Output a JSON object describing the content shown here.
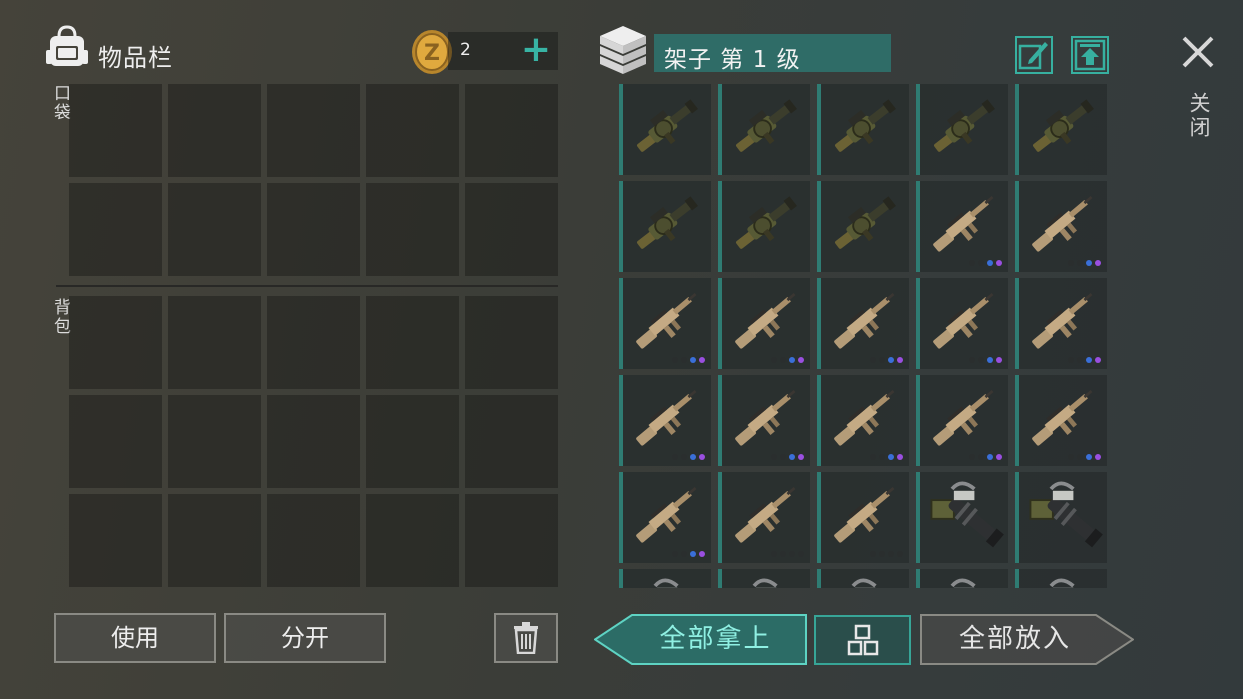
{
  "inventory": {
    "title": "物品栏",
    "coins": "2",
    "pocket_label": "口袋",
    "backpack_label": "背包",
    "pocket_rows": 2,
    "backpack_rows": 3,
    "columns": 5
  },
  "actions": {
    "use": "使用",
    "split": "分开",
    "take_all": "全部拿上",
    "put_all": "全部放入"
  },
  "container": {
    "title": "架子 第 1 级",
    "close_label": "关闭",
    "items": [
      {
        "type": "grenade-launcher",
        "dots": []
      },
      {
        "type": "grenade-launcher",
        "dots": []
      },
      {
        "type": "grenade-launcher",
        "dots": []
      },
      {
        "type": "grenade-launcher",
        "dots": []
      },
      {
        "type": "grenade-launcher",
        "dots": []
      },
      {
        "type": "grenade-launcher",
        "dots": []
      },
      {
        "type": "grenade-launcher",
        "dots": []
      },
      {
        "type": "grenade-launcher",
        "dots": []
      },
      {
        "type": "assault-rifle",
        "dots": [
          "off",
          "off",
          "blue",
          "purple"
        ]
      },
      {
        "type": "assault-rifle",
        "dots": [
          "off",
          "off",
          "blue",
          "purple"
        ]
      },
      {
        "type": "assault-rifle",
        "dots": [
          "off",
          "off",
          "blue",
          "purple"
        ]
      },
      {
        "type": "assault-rifle",
        "dots": [
          "off",
          "off",
          "blue",
          "purple"
        ]
      },
      {
        "type": "assault-rifle",
        "dots": [
          "off",
          "off",
          "blue",
          "purple"
        ]
      },
      {
        "type": "assault-rifle",
        "dots": [
          "off",
          "off",
          "blue",
          "purple"
        ]
      },
      {
        "type": "assault-rifle",
        "dots": [
          "off",
          "off",
          "blue",
          "purple"
        ]
      },
      {
        "type": "assault-rifle",
        "dots": [
          "off",
          "off",
          "blue",
          "purple"
        ]
      },
      {
        "type": "assault-rifle",
        "dots": [
          "off",
          "off",
          "blue",
          "purple"
        ]
      },
      {
        "type": "assault-rifle",
        "dots": [
          "off",
          "off",
          "blue",
          "purple"
        ]
      },
      {
        "type": "assault-rifle",
        "dots": [
          "off",
          "off",
          "blue",
          "purple"
        ]
      },
      {
        "type": "assault-rifle",
        "dots": [
          "off",
          "off",
          "blue",
          "purple"
        ]
      },
      {
        "type": "assault-rifle",
        "dots": [
          "off",
          "off",
          "blue",
          "purple"
        ]
      },
      {
        "type": "assault-rifle",
        "dots": [
          "off",
          "off",
          "off",
          "off"
        ]
      },
      {
        "type": "assault-rifle",
        "dots": [
          "off",
          "off",
          "off",
          "off"
        ]
      },
      {
        "type": "heavy-launcher",
        "dots": []
      },
      {
        "type": "heavy-launcher",
        "dots": []
      },
      {
        "type": "heavy-launcher",
        "dots": []
      },
      {
        "type": "heavy-launcher",
        "dots": []
      },
      {
        "type": "heavy-launcher",
        "dots": []
      },
      {
        "type": "heavy-launcher",
        "dots": []
      },
      {
        "type": "heavy-launcher",
        "dots": []
      }
    ]
  },
  "colors": {
    "accent": "#37b0a0",
    "dot_off": "#2a2e2e",
    "dot_blue": "#3a6fd8",
    "dot_purple": "#9a4fe0"
  },
  "icons": {
    "backpack": "backpack-icon",
    "coin": "coin-icon",
    "add": "plus-icon",
    "shelf": "box-stack-icon",
    "rename": "pencil-icon",
    "upload": "upload-icon",
    "close": "close-icon",
    "trash": "trash-icon",
    "grid": "grid-icon"
  }
}
